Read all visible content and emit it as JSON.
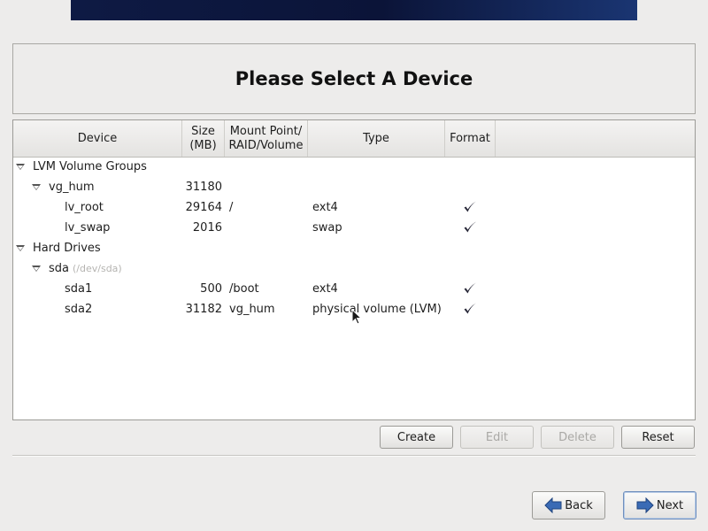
{
  "page": {
    "title": "Please Select A Device"
  },
  "table": {
    "columns": [
      {
        "label": "Device"
      },
      {
        "label": "Size\n(MB)"
      },
      {
        "label": "Mount Point/\nRAID/Volume"
      },
      {
        "label": "Type"
      },
      {
        "label": "Format"
      }
    ],
    "rows": [
      {
        "device": "LVM Volume Groups",
        "size": "",
        "mount": "",
        "type": "",
        "format": false,
        "level": 0,
        "expanded": true,
        "path": ""
      },
      {
        "device": "vg_hum",
        "size": "31180",
        "mount": "",
        "type": "",
        "format": false,
        "level": 1,
        "expanded": true,
        "path": ""
      },
      {
        "device": "lv_root",
        "size": "29164",
        "mount": "/",
        "type": "ext4",
        "format": true,
        "level": 2,
        "expanded": false,
        "path": ""
      },
      {
        "device": "lv_swap",
        "size": "2016",
        "mount": "",
        "type": "swap",
        "format": true,
        "level": 2,
        "expanded": false,
        "path": ""
      },
      {
        "device": "Hard Drives",
        "size": "",
        "mount": "",
        "type": "",
        "format": false,
        "level": 0,
        "expanded": true,
        "path": ""
      },
      {
        "device": "sda",
        "size": "",
        "mount": "",
        "type": "",
        "format": false,
        "level": 1,
        "expanded": true,
        "path": "(/dev/sda)"
      },
      {
        "device": "sda1",
        "size": "500",
        "mount": "/boot",
        "type": "ext4",
        "format": true,
        "level": 2,
        "expanded": false,
        "path": ""
      },
      {
        "device": "sda2",
        "size": "31182",
        "mount": "vg_hum",
        "type": "physical volume (LVM)",
        "format": true,
        "level": 2,
        "expanded": false,
        "path": ""
      }
    ]
  },
  "actions": {
    "create": "Create",
    "edit": "Edit",
    "delete": "Delete",
    "reset": "Reset"
  },
  "nav": {
    "back": "Back",
    "next": "Next"
  },
  "colors": {
    "accent": "#3a6bb5",
    "banner": "#0b1438"
  }
}
